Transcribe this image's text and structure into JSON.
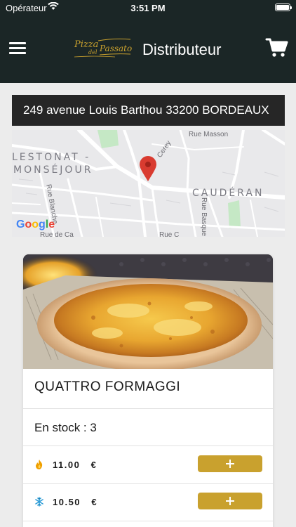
{
  "status_bar": {
    "carrier": "Opérateur",
    "time": "3:51 PM"
  },
  "header": {
    "logo_line1": "Pizza",
    "logo_line2": "del",
    "logo_line3": "Passato",
    "title": "Distributeur"
  },
  "address": "249 avenue Louis Barthou 33200 BORDEAUX",
  "map": {
    "district_left_1": "LESTONAT -",
    "district_left_2": "MONSÉJOUR",
    "district_right": "CAUDÉRAN",
    "street_masson": "Rue Masson",
    "street_cerey": "Cerey",
    "street_blanche": "Rue Blanche",
    "street_basque": "Rue Basque",
    "street_bottom": "Rue de Ca",
    "street_bottom2": "Rue C",
    "google": "Google",
    "colors": {
      "land": "#e9e9eb",
      "road": "#ffffff",
      "park": "#c5e8c5",
      "pin": "#d93b30"
    }
  },
  "product": {
    "name": "QUATTRO FORMAGGI",
    "stock": "En stock : 3",
    "prices": [
      {
        "icon": "flame-icon",
        "value": "11.00",
        "currency": "€",
        "icon_color": "#f0a000"
      },
      {
        "icon": "snowflake-icon",
        "value": "10.50",
        "currency": "€",
        "icon_color": "#2a9bd6"
      }
    ]
  },
  "colors": {
    "nav": "#1b2626",
    "accent": "#c9a12e",
    "background": "#ececec"
  }
}
